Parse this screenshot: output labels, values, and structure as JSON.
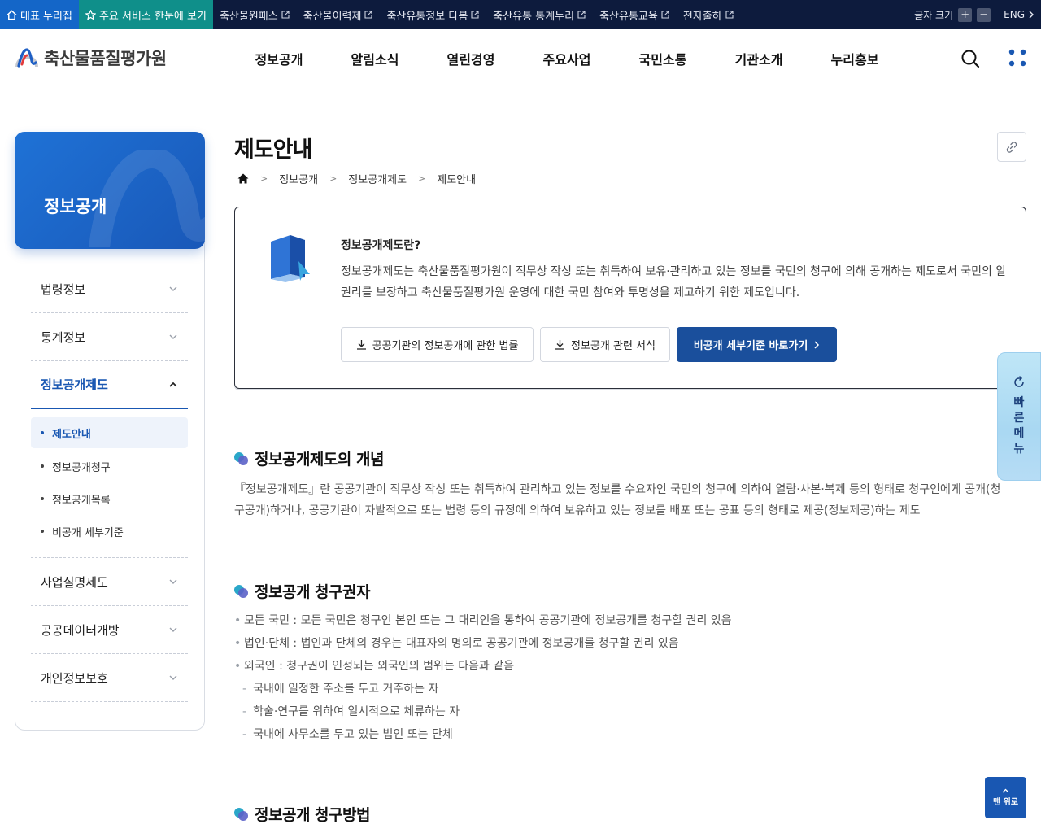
{
  "topbar": {
    "home_label": "대표 누리집",
    "services_label": "주요 서비스 한눈에 보기",
    "links": [
      "축산물원패스",
      "축산물이력제",
      "축산유통정보 다봄",
      "축산유통 통계누리",
      "축산유통교육",
      "전자출하"
    ],
    "font_size_label": "글자 크기",
    "font_plus": "+",
    "font_minus": "−",
    "lang_label": "ENG"
  },
  "header": {
    "logo_text": "축산물품질평가원",
    "nav": [
      "정보공개",
      "알림소식",
      "열린경영",
      "주요사업",
      "국민소통",
      "기관소개",
      "누리홍보"
    ]
  },
  "sidebar": {
    "title": "정보공개",
    "items_before": [
      "법령정보",
      "통계정보"
    ],
    "active_item": "정보공개제도",
    "sub_items": [
      "제도안내",
      "정보공개청구",
      "정보공개목록",
      "비공개 세부기준"
    ],
    "items_after": [
      "사업실명제도",
      "공공데이터개방",
      "개인정보보호"
    ]
  },
  "content": {
    "page_title": "제도안내",
    "breadcrumb": [
      "정보공개",
      "정보공개제도",
      "제도안내"
    ],
    "intro": {
      "question": "정보공개제도란?",
      "description": "정보공개제도는 축산물품질평가원이 직무상 작성 또는 취득하여 보유·관리하고 있는 정보를 국민의 청구에 의해 공개하는 제도로서 국민의 알권리를 보장하고 축산물품질평가원 운영에 대한 국민 참여와 투명성을 제고하기 위한 제도입니다.",
      "buttons": [
        "공공기관의 정보공개에 관한 법률",
        "정보공개 관련 서식",
        "비공개 세부기준 바로가기"
      ]
    },
    "sections": [
      {
        "title": "정보공개제도의 개념",
        "body": "『정보공개제도』란 공공기관이 직무상 작성 또는 취득하여 관리하고 있는 정보를 수요자인 국민의 청구에 의하여 열람·사본·복제 등의 형태로 청구인에게 공개(청구공개)하거나, 공공기관이 자발적으로 또는 법령 등의 규정에 의하여 보유하고 있는 정보를 배포 또는 공표 등의 형태로 제공(정보제공)하는 제도"
      },
      {
        "title": "정보공개 청구권자",
        "items": [
          "모든 국민 : 모든 국민은 청구인 본인 또는 그 대리인을 통하여 공공기관에 정보공개를 청구할 권리 있음",
          "법인·단체 : 법인과 단체의 경우는 대표자의 명의로 공공기관에 정보공개를 청구할 권리 있음",
          "외국인 : 청구권이 인정되는 외국인의 범위는 다음과 같음"
        ],
        "sub_items": [
          "국내에 일정한 주소를 두고 거주하는 자",
          "학술·연구를 위하여 일시적으로 체류하는 자",
          "국내에 사무소를 두고 있는 법인 또는 단체"
        ]
      },
      {
        "title": "정보공개 청구방법"
      }
    ]
  },
  "quick_menu": {
    "label": "빠른메뉴"
  },
  "top_button": {
    "label": "맨 위로"
  },
  "colors": {
    "primary": "#1957b2",
    "topbar_bg": "#0d1b3d",
    "teal": "#0f8f8a"
  }
}
